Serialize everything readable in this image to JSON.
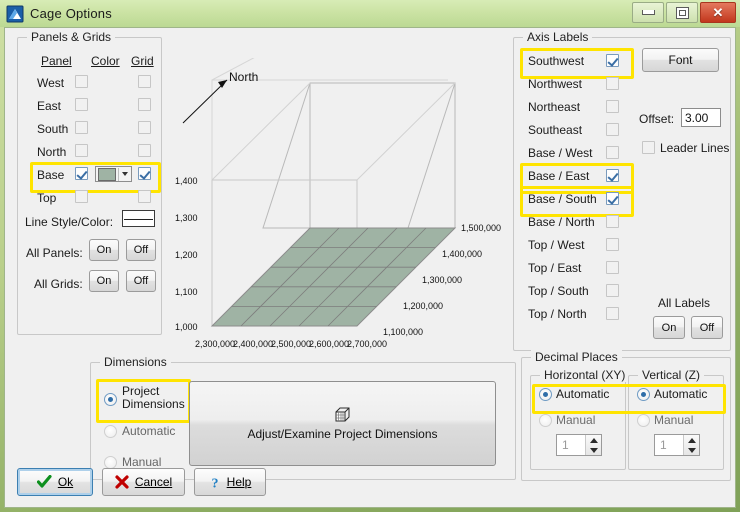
{
  "window": {
    "title": "Cage Options",
    "icon": "app-mountain-icon",
    "controls": {
      "minimize": "minimize-icon",
      "maximize": "maximize-icon",
      "close": "close-icon"
    }
  },
  "panels_grids": {
    "title": "Panels & Grids",
    "columns": {
      "panel": "Panel",
      "color": "Color",
      "grid": "Grid"
    },
    "rows": [
      {
        "label": "West",
        "panel_checked": false,
        "has_color": false,
        "grid_checked": false,
        "highlighted": false
      },
      {
        "label": "East",
        "panel_checked": false,
        "has_color": false,
        "grid_checked": false,
        "highlighted": false
      },
      {
        "label": "South",
        "panel_checked": false,
        "has_color": false,
        "grid_checked": false,
        "highlighted": false
      },
      {
        "label": "North",
        "panel_checked": false,
        "has_color": false,
        "grid_checked": false,
        "highlighted": false
      },
      {
        "label": "Base",
        "panel_checked": true,
        "has_color": true,
        "grid_checked": true,
        "highlighted": true,
        "color": "#9fb3a4"
      },
      {
        "label": "Top",
        "panel_checked": false,
        "has_color": false,
        "grid_checked": false,
        "highlighted": false
      }
    ],
    "line_style_label": "Line Style/Color:",
    "all_panels_label": "All Panels:",
    "all_grids_label": "All Grids:",
    "on_label": "On",
    "off_label": "Off"
  },
  "preview": {
    "north_label": "North",
    "base_color": "#9fb3a4",
    "z_labels": [
      "1,400",
      "1,300",
      "1,200",
      "1,100",
      "1,000"
    ],
    "x_labels": [
      "2,300,000",
      "2,400,000",
      "2,500,000",
      "2,600,000",
      "2,700,000"
    ],
    "y_labels": [
      "1,500,000",
      "1,400,000",
      "1,300,000",
      "1,200,000",
      "1,100,000"
    ]
  },
  "dimensions": {
    "title": "Dimensions",
    "options": [
      {
        "label": "Project Dimensions",
        "selected": true,
        "highlighted": true
      },
      {
        "label": "Automatic",
        "selected": false,
        "highlighted": false
      },
      {
        "label": "Manual",
        "selected": false,
        "highlighted": false
      }
    ],
    "button_label": "Adjust/Examine Project Dimensions",
    "button_icon": "cube-icon"
  },
  "axis_labels": {
    "title": "Axis Labels",
    "items": [
      {
        "label": "Southwest",
        "checked": true,
        "highlighted": true
      },
      {
        "label": "Northwest",
        "checked": false,
        "highlighted": false
      },
      {
        "label": "Northeast",
        "checked": false,
        "highlighted": false
      },
      {
        "label": "Southeast",
        "checked": false,
        "highlighted": false
      },
      {
        "label": "Base / West",
        "checked": false,
        "highlighted": false
      },
      {
        "label": "Base / East",
        "checked": true,
        "highlighted": true
      },
      {
        "label": "Base / South",
        "checked": true,
        "highlighted": true
      },
      {
        "label": "Base / North",
        "checked": false,
        "highlighted": false
      },
      {
        "label": "Top / West",
        "checked": false,
        "highlighted": false
      },
      {
        "label": "Top / East",
        "checked": false,
        "highlighted": false
      },
      {
        "label": "Top / South",
        "checked": false,
        "highlighted": false
      },
      {
        "label": "Top / North",
        "checked": false,
        "highlighted": false
      }
    ],
    "font_button": "Font",
    "offset_label": "Offset:",
    "offset_value": "3.00",
    "leader_lines_label": "Leader Lines",
    "leader_lines_checked": false,
    "all_labels_title": "All Labels",
    "on_label": "On",
    "off_label": "Off"
  },
  "decimal_places": {
    "title": "Decimal Places",
    "horizontal": {
      "title": "Horizontal (XY)",
      "automatic_label": "Automatic",
      "manual_label": "Manual",
      "selected": "Automatic",
      "highlighted": true,
      "spin_value": "1"
    },
    "vertical": {
      "title": "Vertical (Z)",
      "automatic_label": "Automatic",
      "manual_label": "Manual",
      "selected": "Automatic",
      "highlighted": true,
      "spin_value": "1"
    }
  },
  "footer": {
    "ok": "Ok",
    "cancel": "Cancel",
    "help": "Help"
  },
  "colors": {
    "highlight": "#ffe400",
    "titlebar": "#cbe3a4",
    "dialog_bg": "#f0f0f0",
    "base_panel": "#9fb3a4",
    "close_button": "#c2371d"
  }
}
